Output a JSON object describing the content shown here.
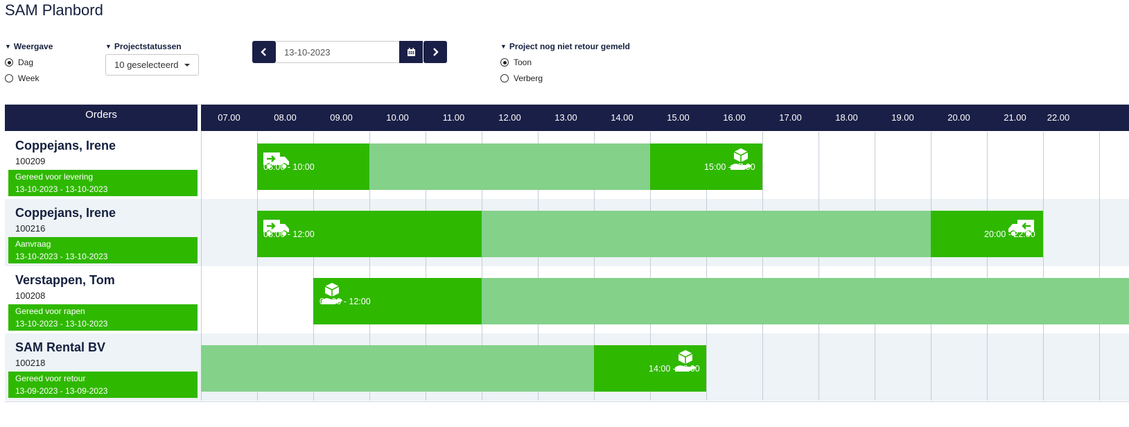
{
  "app": {
    "title": "SAM Planbord"
  },
  "filters": {
    "weergave": {
      "label": "Weergave",
      "options": [
        "Dag",
        "Week"
      ],
      "selected": "Dag"
    },
    "projectstatussen": {
      "label": "Projectstatussen",
      "value": "10 geselecteerd"
    },
    "date": {
      "value": "13-10-2023"
    },
    "retour": {
      "label": "Project nog niet retour gemeld",
      "options": [
        "Toon",
        "Verberg"
      ],
      "selected": "Toon"
    }
  },
  "planner": {
    "orders_label": "Orders",
    "hours": [
      "07.00",
      "08.00",
      "09.00",
      "10.00",
      "11.00",
      "12.00",
      "13.00",
      "14.00",
      "15.00",
      "16.00",
      "17.00",
      "18.00",
      "19.00",
      "20.00",
      "21.00",
      "22.00"
    ],
    "rows": [
      {
        "customer": "Coppejans, Irene",
        "order": "100209",
        "status": "Gereed voor levering",
        "period": "13-10-2023 - 13-10-2023",
        "start_label": "08:00 - 10:00",
        "end_label": "15:00 - 17:00",
        "start_icon": "delivery-truck-icon",
        "end_icon": "hand-package-icon"
      },
      {
        "customer": "Coppejans, Irene",
        "order": "100216",
        "status": "Aanvraag",
        "period": "13-10-2023 - 13-10-2023",
        "start_label": "08:00 - 12:00",
        "end_label": "20:00 - 22:00",
        "start_icon": "delivery-truck-icon",
        "end_icon": "return-truck-icon"
      },
      {
        "customer": "Verstappen, Tom",
        "order": "100208",
        "status": "Gereed voor rapen",
        "period": "13-10-2023 - 13-10-2023",
        "start_label": "09:00 - 12:00",
        "start_icon": "hand-package-icon"
      },
      {
        "customer": "SAM Rental BV",
        "order": "100218",
        "status": "Gereed voor retour",
        "period": "13-09-2023 - 13-09-2023",
        "end_label": "14:00 - 16:00",
        "end_icon": "hand-package-icon"
      }
    ]
  },
  "colors": {
    "navy": "#1a1f47",
    "green": "#2fb800",
    "light_green": "#84d18a",
    "row_alt": "#edf3f6"
  }
}
